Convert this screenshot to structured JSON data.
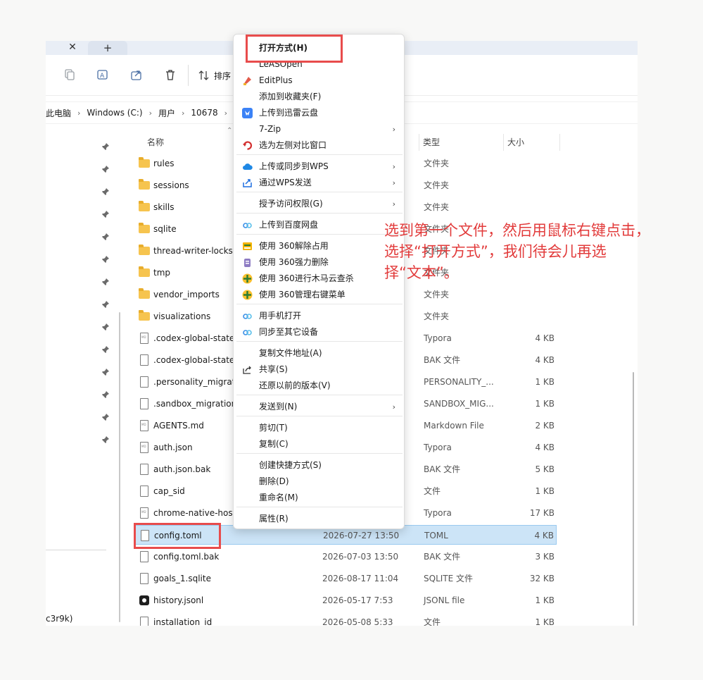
{
  "tabs": {
    "close_glyph": "✕",
    "new_glyph": "+"
  },
  "toolbar": {
    "sort_label": "排序"
  },
  "breadcrumb": [
    {
      "label": "此电脑"
    },
    {
      "label": "Windows (C:)"
    },
    {
      "label": "用户"
    },
    {
      "label": "10678"
    }
  ],
  "nav": {
    "bottom_text": "c3r9k)"
  },
  "columns": {
    "name": "名称",
    "type": "类型",
    "size": "大小"
  },
  "files": [
    {
      "name": "rules",
      "date": "",
      "type": "文件夹",
      "size": "",
      "icon": "folder-icon"
    },
    {
      "name": "sessions",
      "date": "",
      "type": "文件夹",
      "size": "",
      "icon": "folder-icon"
    },
    {
      "name": "skills",
      "date": "",
      "type": "文件夹",
      "size": "",
      "icon": "folder-icon"
    },
    {
      "name": "sqlite",
      "date": "",
      "type": "文件夹",
      "size": "",
      "icon": "folder-icon"
    },
    {
      "name": "thread-writer-locks",
      "date": "",
      "type": "文件夹",
      "size": "",
      "icon": "folder-icon"
    },
    {
      "name": "tmp",
      "date": "",
      "type": "文件夹",
      "size": "",
      "icon": "folder-icon"
    },
    {
      "name": "vendor_imports",
      "date": "",
      "type": "文件夹",
      "size": "",
      "icon": "folder-icon"
    },
    {
      "name": "visualizations",
      "date": "",
      "type": "文件夹",
      "size": "",
      "icon": "folder-icon"
    },
    {
      "name": ".codex-global-state",
      "date": "",
      "type": "Typora",
      "size": "4 KB",
      "icon": "typora-file-icon"
    },
    {
      "name": ".codex-global-state",
      "date": "",
      "type": "BAK 文件",
      "size": "4 KB",
      "icon": "file-icon"
    },
    {
      "name": ".personality_migration",
      "date": "",
      "type": "PERSONALITY_...",
      "size": "1 KB",
      "icon": "file-icon"
    },
    {
      "name": ".sandbox_migration",
      "date": "",
      "type": "SANDBOX_MIG...",
      "size": "1 KB",
      "icon": "file-icon"
    },
    {
      "name": "AGENTS.md",
      "date": "",
      "type": "Markdown File",
      "size": "2 KB",
      "icon": "typora-file-icon"
    },
    {
      "name": "auth.json",
      "date": "",
      "type": "Typora",
      "size": "4 KB",
      "icon": "typora-file-icon"
    },
    {
      "name": "auth.json.bak",
      "date": "",
      "type": "BAK 文件",
      "size": "5 KB",
      "icon": "file-icon"
    },
    {
      "name": "cap_sid",
      "date": "",
      "type": "文件",
      "size": "1 KB",
      "icon": "file-icon"
    },
    {
      "name": "chrome-native-host",
      "date": "",
      "type": "Typora",
      "size": "17 KB",
      "icon": "typora-file-icon"
    },
    {
      "name": "config.toml",
      "date": "2026-07-27 13:50",
      "type": "TOML",
      "size": "4 KB",
      "icon": "file-icon",
      "selected": true
    },
    {
      "name": "config.toml.bak",
      "date": "2026-07-03 13:50",
      "type": "BAK 文件",
      "size": "3 KB",
      "icon": "file-icon"
    },
    {
      "name": "goals_1.sqlite",
      "date": "2026-08-17 11:04",
      "type": "SQLITE 文件",
      "size": "32 KB",
      "icon": "file-icon"
    },
    {
      "name": "history.jsonl",
      "date": "2026-05-17 7:53",
      "type": "JSONL file",
      "size": "1 KB",
      "icon": "jsonl-icon"
    },
    {
      "name": "installation_id",
      "date": "2026-05-08 5:33",
      "type": "文件",
      "size": "1 KB",
      "icon": "file-icon"
    }
  ],
  "context_menu": {
    "items": [
      {
        "label": "打开方式(H)",
        "bold": true,
        "icon": "",
        "arrow": false
      },
      {
        "label": "LeASOpen",
        "icon": "",
        "arrow": false
      },
      {
        "label": "EditPlus",
        "icon": "editplus-icon",
        "arrow": false
      },
      {
        "label": "添加到收藏夹(F)",
        "icon": "",
        "arrow": false
      },
      {
        "label": "上传到迅雷云盘",
        "icon": "thunder-icon",
        "arrow": false
      },
      {
        "label": "7-Zip",
        "icon": "",
        "arrow": true
      },
      {
        "label": "选为左侧对比窗口",
        "icon": "compare-icon",
        "arrow": false,
        "sep_after": true
      },
      {
        "label": "上传或同步到WPS",
        "icon": "wps-cloud-icon",
        "arrow": true
      },
      {
        "label": "通过WPS发送",
        "icon": "wps-send-icon",
        "arrow": true,
        "sep_after": true
      },
      {
        "label": "授予访问权限(G)",
        "icon": "",
        "arrow": true,
        "sep_after": true
      },
      {
        "label": "上传到百度网盘",
        "icon": "baidu-icon",
        "arrow": false,
        "sep_after": true
      },
      {
        "label": "使用 360解除占用",
        "icon": "360-unlock-icon",
        "arrow": false
      },
      {
        "label": "使用 360强力删除",
        "icon": "360-delete-icon",
        "arrow": false
      },
      {
        "label": "使用 360进行木马云查杀",
        "icon": "360-scan-icon",
        "arrow": false
      },
      {
        "label": "使用 360管理右键菜单",
        "icon": "360-manage-icon",
        "arrow": false,
        "sep_after": true
      },
      {
        "label": "用手机打开",
        "icon": "phone-open-icon",
        "arrow": false
      },
      {
        "label": "同步至其它设备",
        "icon": "sync-device-icon",
        "arrow": false,
        "sep_after": true
      },
      {
        "label": "复制文件地址(A)",
        "icon": "",
        "arrow": false
      },
      {
        "label": "共享(S)",
        "icon": "share-icon",
        "arrow": false
      },
      {
        "label": "还原以前的版本(V)",
        "icon": "",
        "arrow": false,
        "sep_after": true
      },
      {
        "label": "发送到(N)",
        "icon": "",
        "arrow": true,
        "sep_after": true
      },
      {
        "label": "剪切(T)",
        "icon": "",
        "arrow": false
      },
      {
        "label": "复制(C)",
        "icon": "",
        "arrow": false,
        "sep_after": true
      },
      {
        "label": "创建快捷方式(S)",
        "icon": "",
        "arrow": false
      },
      {
        "label": "删除(D)",
        "icon": "",
        "arrow": false
      },
      {
        "label": "重命名(M)",
        "icon": "",
        "arrow": false,
        "sep_after": true
      },
      {
        "label": "属性(R)",
        "icon": "",
        "arrow": false
      }
    ]
  },
  "annotation": {
    "line1": "选到第一个文件，然后用鼠标右键点击，",
    "line2": "选择“打开方式”，我们待会儿再选",
    "line3": "择“文本”。"
  },
  "colors": {
    "highlight": "#e84c4c",
    "annotation": "#e23b3b",
    "selection": "#cce4f7"
  }
}
